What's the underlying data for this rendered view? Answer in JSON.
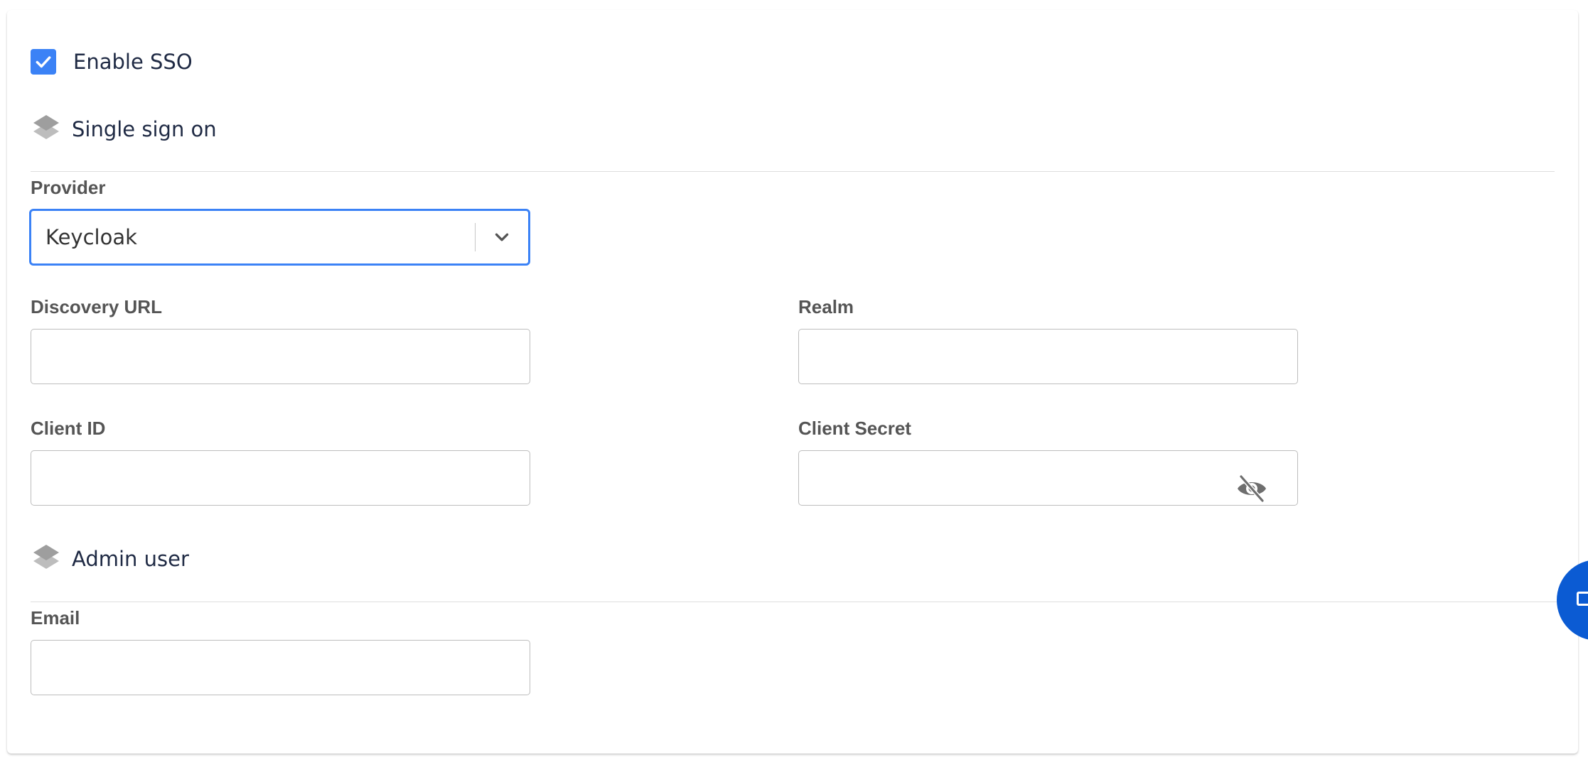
{
  "sso": {
    "enable_label": "Enable SSO",
    "enabled": true
  },
  "sections": {
    "single_sign_on": {
      "title": "Single sign on",
      "icon": "layers-icon"
    },
    "admin_user": {
      "title": "Admin user",
      "icon": "layers-icon"
    }
  },
  "fields": {
    "provider": {
      "label": "Provider",
      "value": "Keycloak"
    },
    "discovery_url": {
      "label": "Discovery URL",
      "value": ""
    },
    "realm": {
      "label": "Realm",
      "value": ""
    },
    "client_id": {
      "label": "Client ID",
      "value": ""
    },
    "client_secret": {
      "label": "Client Secret",
      "value": "",
      "toggle_icon": "eye-off-icon"
    },
    "email": {
      "label": "Email",
      "value": ""
    }
  },
  "colors": {
    "accent": "#3b82f6",
    "fab": "#0b5bd3",
    "label": "#555555",
    "heading": "#1f2a44"
  }
}
